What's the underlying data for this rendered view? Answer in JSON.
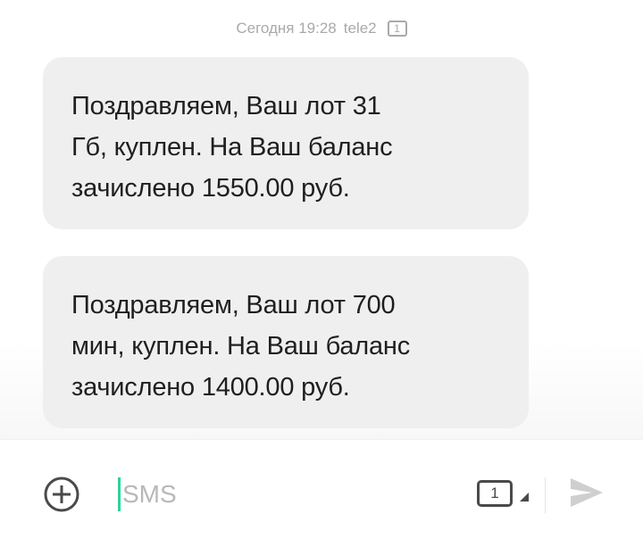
{
  "thread": {
    "meta": {
      "date": "Сегодня 19:28",
      "sender": "tele2",
      "sim_slot": "1"
    },
    "messages": [
      {
        "lines": [
          "Поздравляем, Ваш лот 31",
          "Гб, куплен. На Ваш баланс",
          "зачислено 1550.00 руб."
        ]
      },
      {
        "lines": [
          "Поздравляем, Ваш лот 700",
          "мин, куплен. На Ваш баланс",
          "зачислено 1400.00 руб."
        ]
      }
    ]
  },
  "composer": {
    "placeholder": "SMS",
    "sim_slot": "1",
    "attach_icon": "plus-circle-icon",
    "send_icon": "send-icon"
  },
  "colors": {
    "bubble": "#efefef",
    "meta_text": "#a9a9a9",
    "caret": "#2bd39d",
    "send_disabled": "#cfcfcf"
  }
}
